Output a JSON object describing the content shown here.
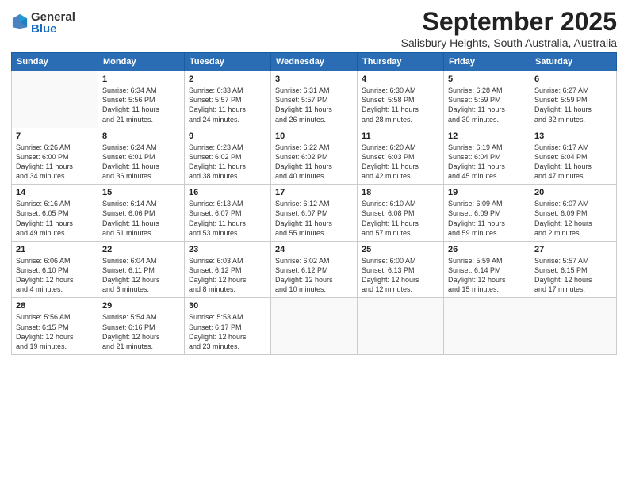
{
  "header": {
    "logo_general": "General",
    "logo_blue": "Blue",
    "title": "September 2025",
    "subtitle": "Salisbury Heights, South Australia, Australia"
  },
  "days_of_week": [
    "Sunday",
    "Monday",
    "Tuesday",
    "Wednesday",
    "Thursday",
    "Friday",
    "Saturday"
  ],
  "weeks": [
    [
      {
        "day": "",
        "info": ""
      },
      {
        "day": "1",
        "info": "Sunrise: 6:34 AM\nSunset: 5:56 PM\nDaylight: 11 hours\nand 21 minutes."
      },
      {
        "day": "2",
        "info": "Sunrise: 6:33 AM\nSunset: 5:57 PM\nDaylight: 11 hours\nand 24 minutes."
      },
      {
        "day": "3",
        "info": "Sunrise: 6:31 AM\nSunset: 5:57 PM\nDaylight: 11 hours\nand 26 minutes."
      },
      {
        "day": "4",
        "info": "Sunrise: 6:30 AM\nSunset: 5:58 PM\nDaylight: 11 hours\nand 28 minutes."
      },
      {
        "day": "5",
        "info": "Sunrise: 6:28 AM\nSunset: 5:59 PM\nDaylight: 11 hours\nand 30 minutes."
      },
      {
        "day": "6",
        "info": "Sunrise: 6:27 AM\nSunset: 5:59 PM\nDaylight: 11 hours\nand 32 minutes."
      }
    ],
    [
      {
        "day": "7",
        "info": "Sunrise: 6:26 AM\nSunset: 6:00 PM\nDaylight: 11 hours\nand 34 minutes."
      },
      {
        "day": "8",
        "info": "Sunrise: 6:24 AM\nSunset: 6:01 PM\nDaylight: 11 hours\nand 36 minutes."
      },
      {
        "day": "9",
        "info": "Sunrise: 6:23 AM\nSunset: 6:02 PM\nDaylight: 11 hours\nand 38 minutes."
      },
      {
        "day": "10",
        "info": "Sunrise: 6:22 AM\nSunset: 6:02 PM\nDaylight: 11 hours\nand 40 minutes."
      },
      {
        "day": "11",
        "info": "Sunrise: 6:20 AM\nSunset: 6:03 PM\nDaylight: 11 hours\nand 42 minutes."
      },
      {
        "day": "12",
        "info": "Sunrise: 6:19 AM\nSunset: 6:04 PM\nDaylight: 11 hours\nand 45 minutes."
      },
      {
        "day": "13",
        "info": "Sunrise: 6:17 AM\nSunset: 6:04 PM\nDaylight: 11 hours\nand 47 minutes."
      }
    ],
    [
      {
        "day": "14",
        "info": "Sunrise: 6:16 AM\nSunset: 6:05 PM\nDaylight: 11 hours\nand 49 minutes."
      },
      {
        "day": "15",
        "info": "Sunrise: 6:14 AM\nSunset: 6:06 PM\nDaylight: 11 hours\nand 51 minutes."
      },
      {
        "day": "16",
        "info": "Sunrise: 6:13 AM\nSunset: 6:07 PM\nDaylight: 11 hours\nand 53 minutes."
      },
      {
        "day": "17",
        "info": "Sunrise: 6:12 AM\nSunset: 6:07 PM\nDaylight: 11 hours\nand 55 minutes."
      },
      {
        "day": "18",
        "info": "Sunrise: 6:10 AM\nSunset: 6:08 PM\nDaylight: 11 hours\nand 57 minutes."
      },
      {
        "day": "19",
        "info": "Sunrise: 6:09 AM\nSunset: 6:09 PM\nDaylight: 11 hours\nand 59 minutes."
      },
      {
        "day": "20",
        "info": "Sunrise: 6:07 AM\nSunset: 6:09 PM\nDaylight: 12 hours\nand 2 minutes."
      }
    ],
    [
      {
        "day": "21",
        "info": "Sunrise: 6:06 AM\nSunset: 6:10 PM\nDaylight: 12 hours\nand 4 minutes."
      },
      {
        "day": "22",
        "info": "Sunrise: 6:04 AM\nSunset: 6:11 PM\nDaylight: 12 hours\nand 6 minutes."
      },
      {
        "day": "23",
        "info": "Sunrise: 6:03 AM\nSunset: 6:12 PM\nDaylight: 12 hours\nand 8 minutes."
      },
      {
        "day": "24",
        "info": "Sunrise: 6:02 AM\nSunset: 6:12 PM\nDaylight: 12 hours\nand 10 minutes."
      },
      {
        "day": "25",
        "info": "Sunrise: 6:00 AM\nSunset: 6:13 PM\nDaylight: 12 hours\nand 12 minutes."
      },
      {
        "day": "26",
        "info": "Sunrise: 5:59 AM\nSunset: 6:14 PM\nDaylight: 12 hours\nand 15 minutes."
      },
      {
        "day": "27",
        "info": "Sunrise: 5:57 AM\nSunset: 6:15 PM\nDaylight: 12 hours\nand 17 minutes."
      }
    ],
    [
      {
        "day": "28",
        "info": "Sunrise: 5:56 AM\nSunset: 6:15 PM\nDaylight: 12 hours\nand 19 minutes."
      },
      {
        "day": "29",
        "info": "Sunrise: 5:54 AM\nSunset: 6:16 PM\nDaylight: 12 hours\nand 21 minutes."
      },
      {
        "day": "30",
        "info": "Sunrise: 5:53 AM\nSunset: 6:17 PM\nDaylight: 12 hours\nand 23 minutes."
      },
      {
        "day": "",
        "info": ""
      },
      {
        "day": "",
        "info": ""
      },
      {
        "day": "",
        "info": ""
      },
      {
        "day": "",
        "info": ""
      }
    ]
  ]
}
